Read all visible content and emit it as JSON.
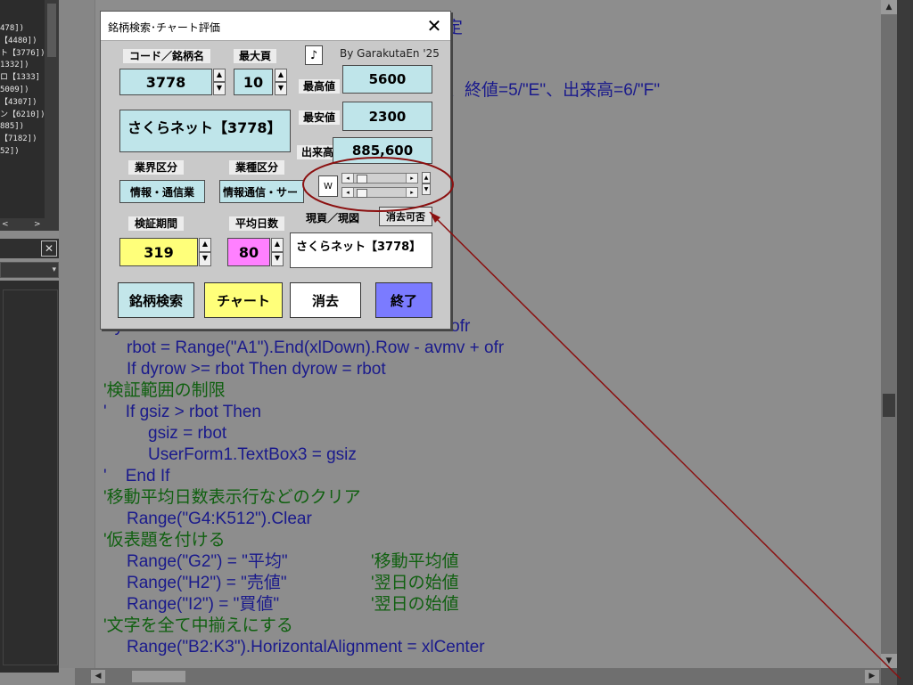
{
  "explorer": {
    "items": [
      "478])",
      "【4480])",
      "ト【3776])",
      "1332])",
      "ロ【1333]",
      "5009])",
      "【4307])",
      "ン【6210])",
      "885])",
      "【7182])",
      "52])"
    ],
    "hscroll_left": "<",
    "hscroll_right": ">",
    "props_close": "✕",
    "props_combo_arrow": "▾"
  },
  "code": {
    "lines": [
      {
        "text": "定",
        "comment": false
      },
      {
        "text": "、終値=5/\"E\"、出来高=6/\"F\"",
        "comment": false
      },
      {
        "text": "dyrow = UserForm1.TextBox3.Value - avmv + ofr",
        "comment": false
      },
      {
        "text": "rbot = Range(\"A1\").End(xlDown).Row - avmv + ofr",
        "comment": false
      },
      {
        "text": "If dyrow >= rbot Then dyrow = rbot",
        "comment": false
      },
      {
        "text": "'検証範囲の制限",
        "comment": true
      },
      {
        "text": "'    If gsiz > rbot Then",
        "comment": false
      },
      {
        "text": "gsiz = rbot",
        "comment": false
      },
      {
        "text": "UserForm1.TextBox3 = gsiz",
        "comment": false
      },
      {
        "text": "'    End If",
        "comment": false
      },
      {
        "text": "'移動平均日数表示行などのクリア",
        "comment": true
      },
      {
        "text": "Range(\"G4:K512\").Clear",
        "comment": false
      },
      {
        "text": "'仮表題を付ける",
        "comment": true
      },
      {
        "text": "Range(\"G2\") = \"平均\"",
        "comment": false
      },
      {
        "text": "'移動平均値",
        "comment": true
      },
      {
        "text": "Range(\"H2\") = \"売値\"",
        "comment": false
      },
      {
        "text": "'翌日の始値",
        "comment": true
      },
      {
        "text": "Range(\"I2\") = \"買値\"",
        "comment": false
      },
      {
        "text": "'翌日の始値",
        "comment": true
      },
      {
        "text": "'文字を全て中揃えにする",
        "comment": true
      },
      {
        "text": "Range(\"B2:K3\").HorizontalAlignment = xlCenter",
        "comment": false
      }
    ]
  },
  "dialog": {
    "title": "銘柄検索･チャート評価",
    "close": "✕",
    "credit": "By GarakutaEn '25",
    "music_btn": "♪",
    "label_code": "コード／銘柄名",
    "label_maxpage": "最大頁",
    "code_value": "3778",
    "maxpage_value": "10",
    "label_high": "最高値",
    "high_value": "5600",
    "label_low": "最安値",
    "low_value": "2300",
    "label_volume": "出来高",
    "volume_value": "885,600",
    "name_value": "さくらネット【3778】",
    "label_industry": "業界区分",
    "label_sector": "業種区分",
    "industry_value": "情報・通信業",
    "sector_value": "情報通信・サー",
    "scroll_box": "W",
    "label_period": "検証期間",
    "label_avgdays": "平均日数",
    "label_page": "現頁／現図",
    "label_deleteable": "消去可否",
    "period_value": "319",
    "avgdays_value": "80",
    "page_value": "さくらネット【3778】",
    "btn_search": "銘柄検索",
    "btn_chart": "チャート",
    "btn_clear": "消去",
    "btn_exit": "終了"
  },
  "colors": {
    "annotation": "#8b1010",
    "exit_button": "#7b7bff",
    "chart_button": "#ffff7a",
    "magenta_field": "#ff80ff",
    "yellow_field": "#ffff7a",
    "cyan_field": "#bfe5ea"
  }
}
